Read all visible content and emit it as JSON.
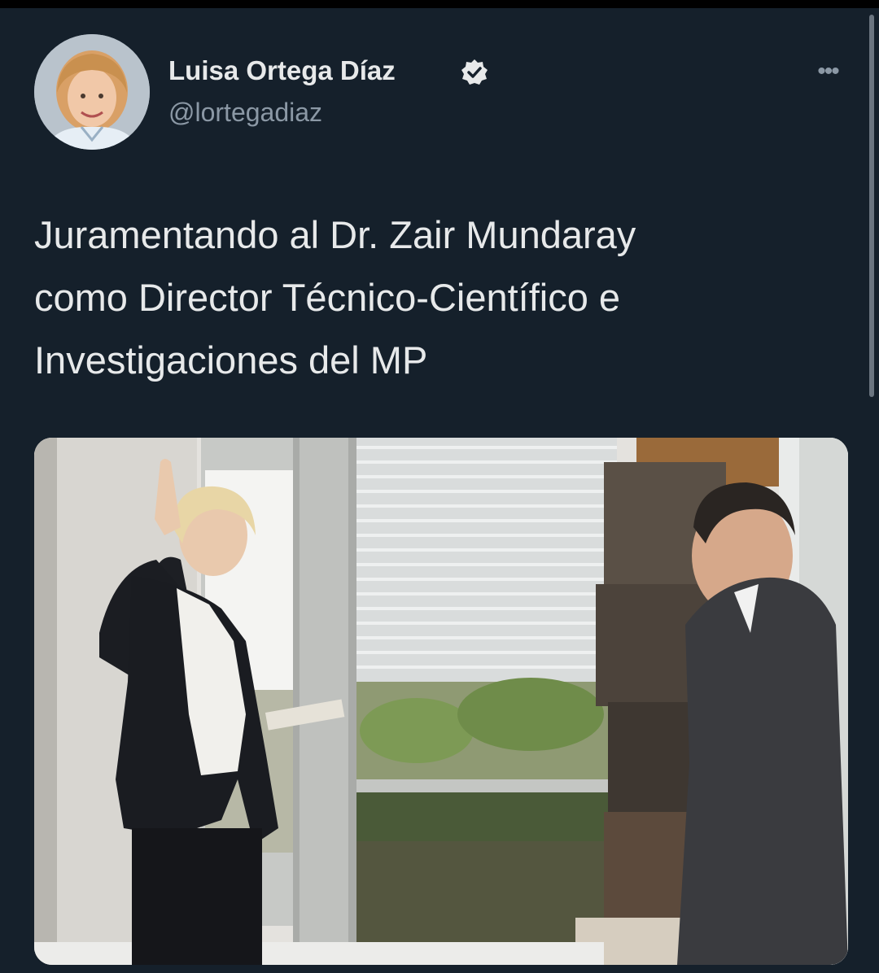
{
  "tweet": {
    "author": {
      "name": "Luisa Ortega Díaz",
      "handle": "@lortegadiaz",
      "verified": true,
      "avatar_icon": "profile-photo"
    },
    "more_label": "•••",
    "text_lines": [
      "Juramentando al Dr. Zair Mundaray",
      "como Director Técnico-Científico e",
      "Investigaciones del MP"
    ],
    "media": {
      "kind": "photo",
      "icon": "photo-swearing-in"
    }
  },
  "colors": {
    "background": "#15202b",
    "text_primary": "#e7e9ea",
    "text_secondary": "#8b98a5",
    "verified_badge": "#e7e9ea"
  }
}
